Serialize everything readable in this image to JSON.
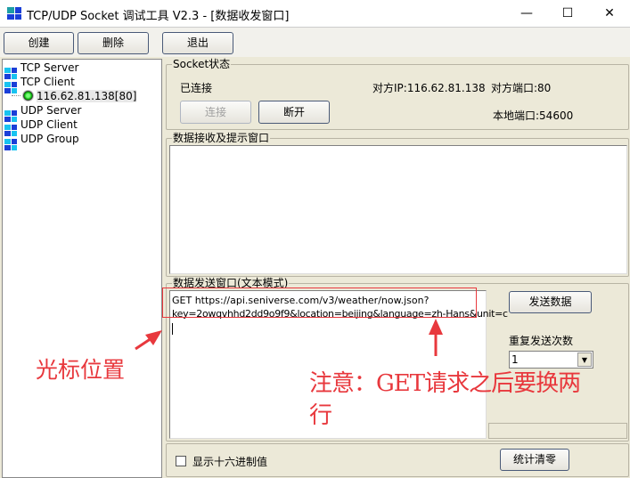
{
  "window": {
    "title": "TCP/UDP Socket 调试工具 V2.3 - [数据收发窗口]",
    "minimize": "—",
    "maximize": "☐",
    "close": "✕"
  },
  "toolbar": {
    "create": "创建",
    "delete": "删除",
    "exit": "退出"
  },
  "tree": {
    "items": [
      "TCP Server",
      "TCP Client",
      "116.62.81.138[80]",
      "UDP Server",
      "UDP Client",
      "UDP Group"
    ]
  },
  "socket_status": {
    "legend": "Socket状态",
    "state": "已连接",
    "remote_ip": "对方IP:116.62.81.138",
    "remote_port": "对方端口:80",
    "local_port": "本地端口:54600",
    "connect": "连接",
    "disconnect": "断开"
  },
  "receive": {
    "legend": "数据接收及提示窗口",
    "content": ""
  },
  "send": {
    "legend": "数据发送窗口(文本模式)",
    "line1": "GET https://api.seniverse.com/v3/weather/now.json?",
    "line2": "key=2owqvhhd2dd9o9f9&location=beijing&language=zh-Hans&unit=c",
    "send_button": "发送数据",
    "repeat_label": "重复发送次数",
    "repeat_value": "1"
  },
  "bottom": {
    "hex_label": "显示十六进制值",
    "hex_checked": false,
    "clear_stats": "统计清零"
  },
  "annotations": {
    "cursor": "光标位置",
    "note_line1": "注意：GET请求之后要换两",
    "note_line2": "行",
    "color": "#e8383d"
  }
}
